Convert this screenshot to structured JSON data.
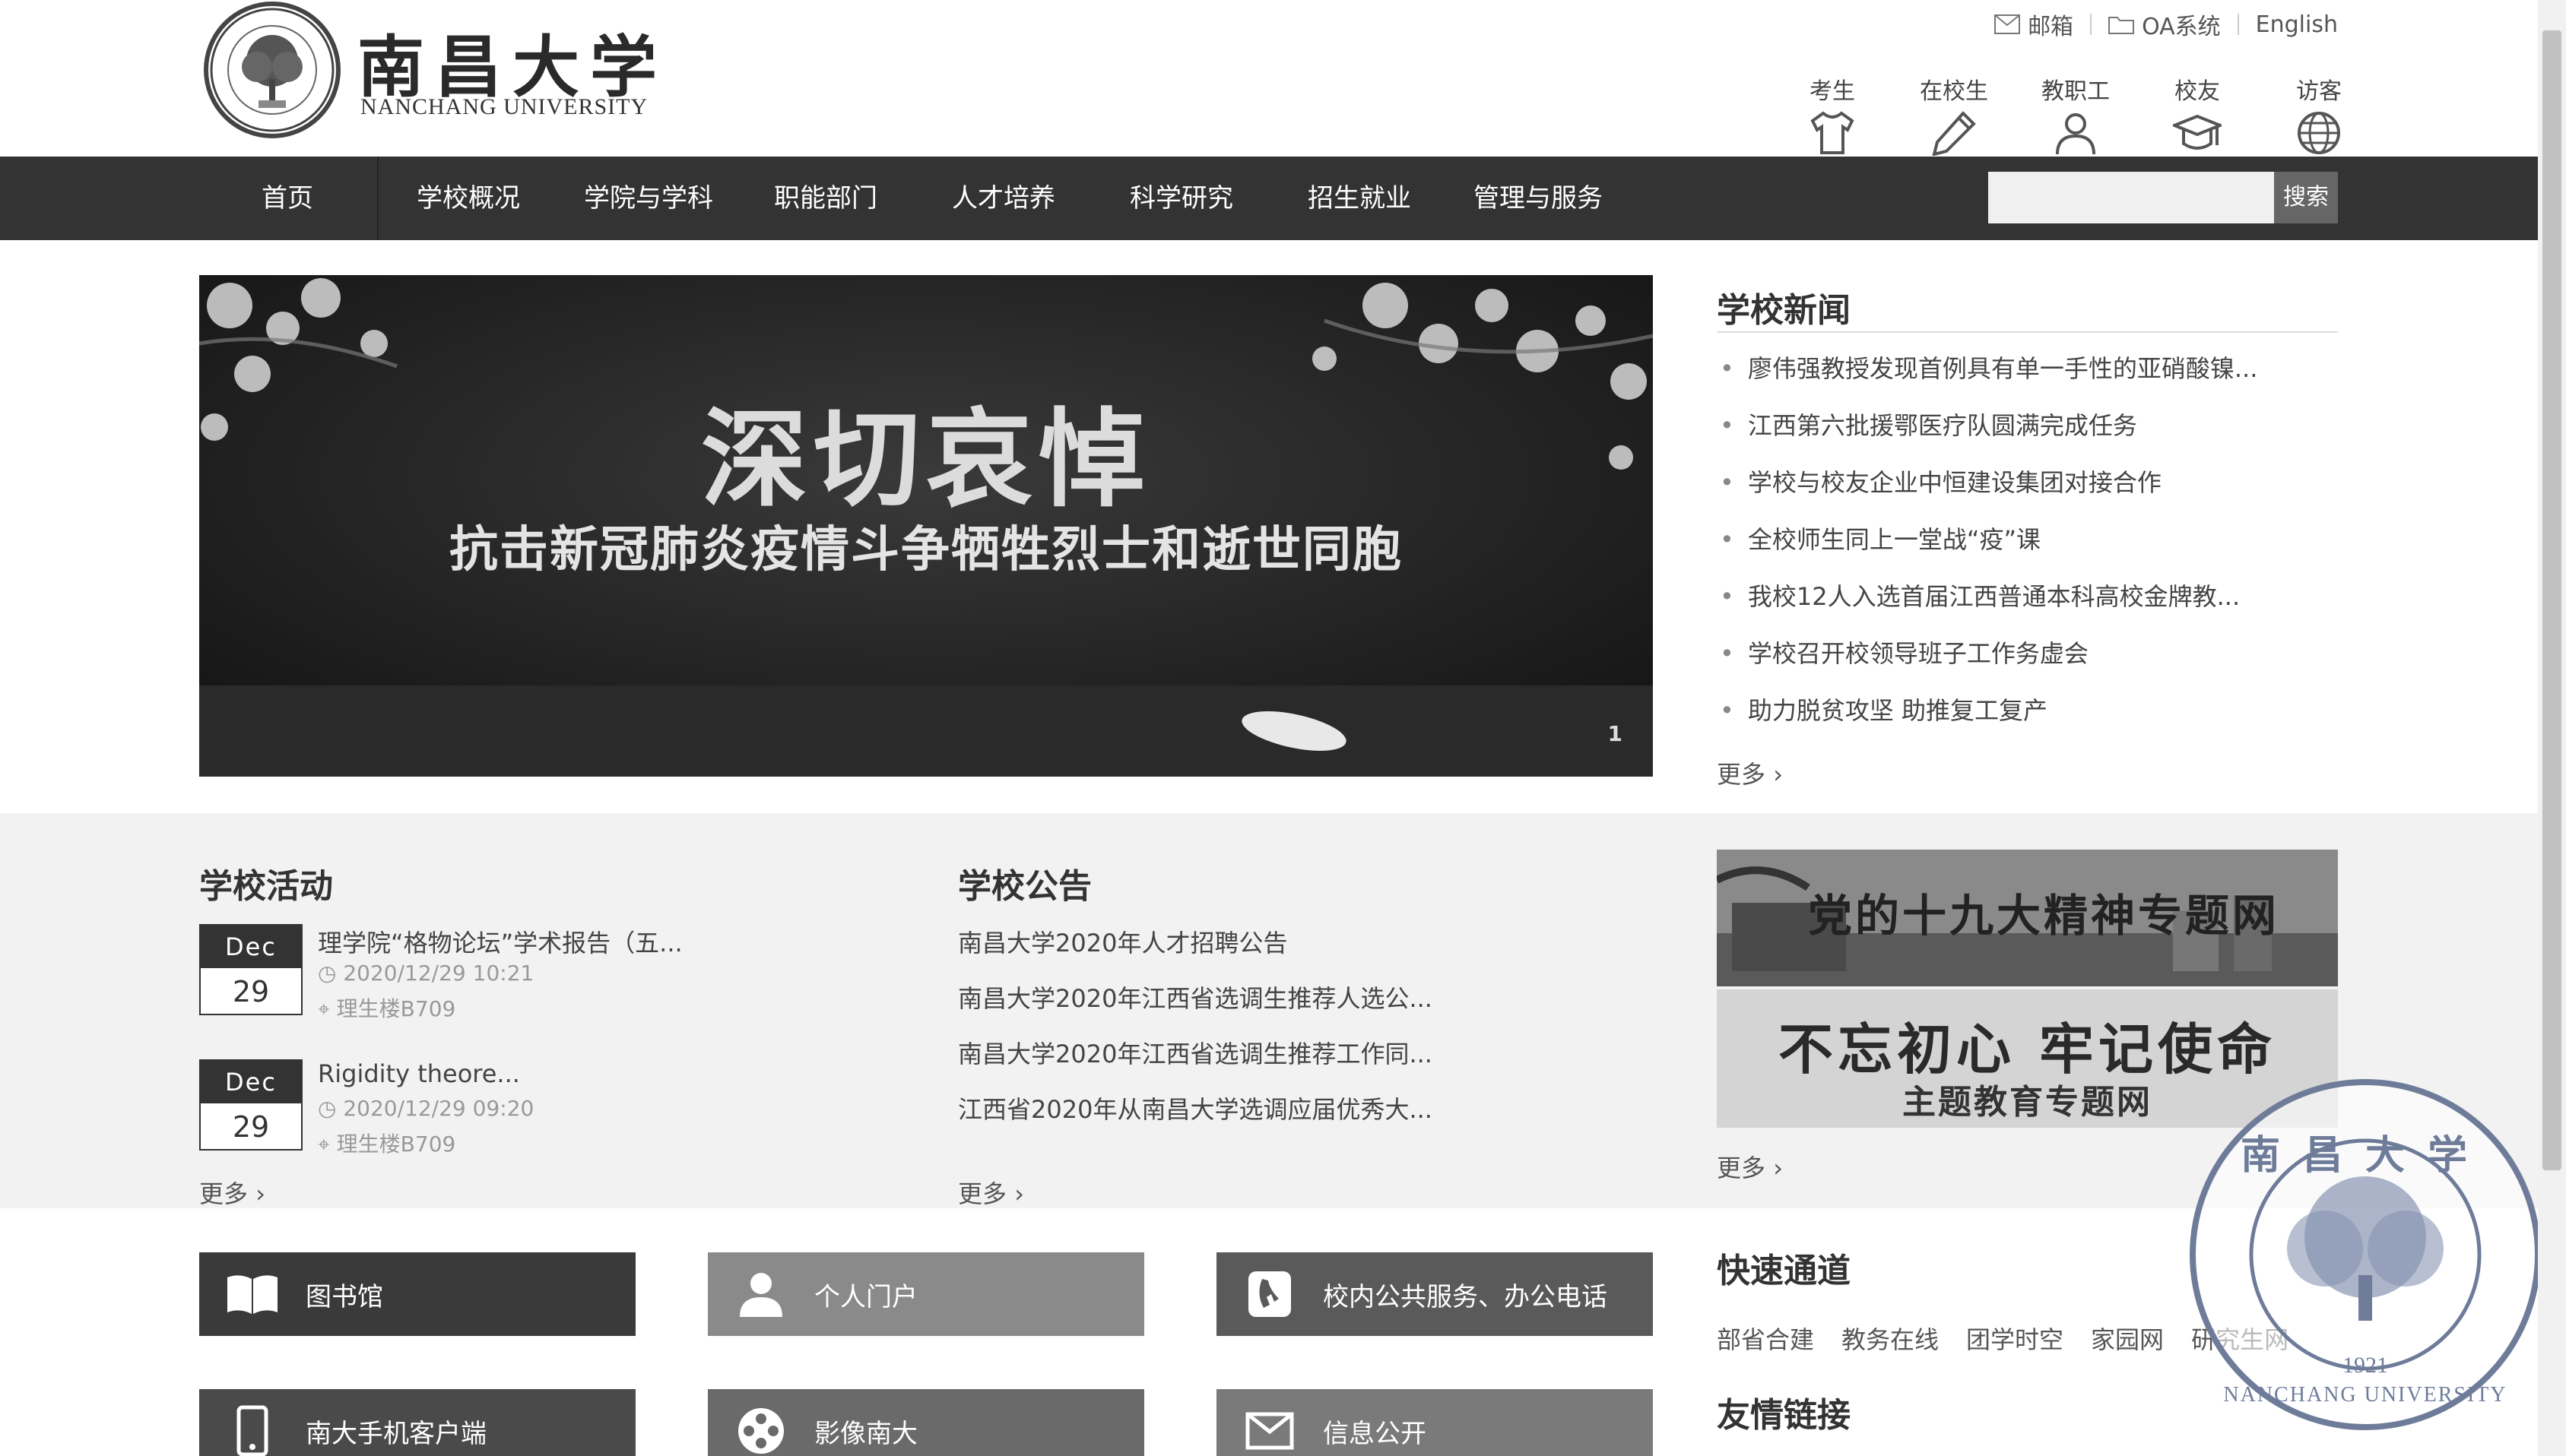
{
  "top_links": {
    "mail": "邮箱",
    "oa": "OA系统",
    "english": "English"
  },
  "logo": {
    "name_cn": "南昌大学",
    "name_en": "NANCHANG UNIVERSITY"
  },
  "roles": [
    {
      "label": "考生",
      "icon": "shirt-icon"
    },
    {
      "label": "在校生",
      "icon": "pencil-icon"
    },
    {
      "label": "教职工",
      "icon": "person-icon"
    },
    {
      "label": "校友",
      "icon": "graduation-cap-icon"
    },
    {
      "label": "访客",
      "icon": "globe-icon"
    }
  ],
  "nav": {
    "items": [
      "首页",
      "学校概况",
      "学院与学科",
      "职能部门",
      "人才培养",
      "科学研究",
      "招生就业",
      "管理与服务"
    ],
    "search_button": "搜索",
    "search_placeholder": ""
  },
  "banner": {
    "title": "深切哀悼",
    "subtitle": "抗击新冠肺炎疫情斗争牺牲烈士和逝世同胞",
    "page": "1"
  },
  "news": {
    "title": "学校新闻",
    "items": [
      "廖伟强教授发现首例具有单一手性的亚硝酸镍...",
      "江西第六批援鄂医疗队圆满完成任务",
      "学校与校友企业中恒建设集团对接合作",
      "全校师生同上一堂战“疫”课",
      "我校12人入选首届江西普通本科高校金牌教...",
      "学校召开校领导班子工作务虚会",
      "助力脱贫攻坚 助推复工复产"
    ],
    "more": "更多"
  },
  "activities": {
    "title": "学校活动",
    "items": [
      {
        "month": "Dec",
        "day": "29",
        "title": "理学院“格物论坛”学术报告（五...",
        "time": "2020/12/29 10:21",
        "place": "理生楼B709"
      },
      {
        "month": "Dec",
        "day": "29",
        "title": "Rigidity theore...",
        "time": "2020/12/29 09:20",
        "place": "理生楼B709"
      }
    ],
    "more": "更多"
  },
  "notices": {
    "title": "学校公告",
    "items": [
      "南昌大学2020年人才招聘公告",
      "南昌大学2020年江西省选调生推荐人选公...",
      "南昌大学2020年江西省选调生推荐工作同...",
      "江西省2020年从南昌大学选调应届优秀大..."
    ],
    "more": "更多"
  },
  "promos": {
    "p1": "党的十九大精神专题网",
    "p2_line1": "不忘初心 牢记使命",
    "p2_line2": "主题教育专题网",
    "more": "更多"
  },
  "quick_buttons": [
    {
      "label": "图书馆",
      "icon": "book-icon",
      "color": "#3a3a3a"
    },
    {
      "label": "个人门户",
      "icon": "user-icon",
      "color": "#8a8a8a"
    },
    {
      "label": "校内公共服务、办公电话",
      "icon": "phone-icon",
      "color": "#5a5a5a"
    },
    {
      "label": "南大手机客户端",
      "icon": "mobile-icon",
      "color": "#4a4a4a"
    },
    {
      "label": "影像南大",
      "icon": "film-reel-icon",
      "color": "#6a6a6a"
    },
    {
      "label": "信息公开",
      "icon": "envelope-icon",
      "color": "#7a7a7a"
    }
  ],
  "fast_channel": {
    "title": "快速通道",
    "links": [
      "部省合建",
      "教务在线",
      "团学时空",
      "家园网",
      "研究生网"
    ]
  },
  "friend_links": {
    "title": "友情链接"
  },
  "seal": {
    "name_cn": "南昌大学",
    "name_en": "NANCHANG UNIVERSITY",
    "year": "1921"
  }
}
